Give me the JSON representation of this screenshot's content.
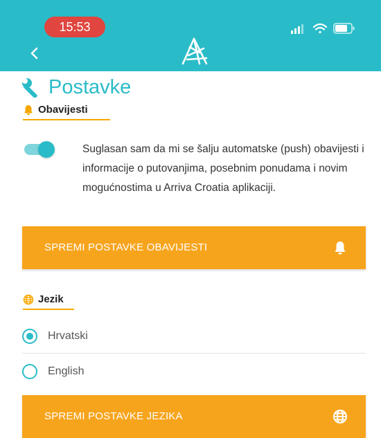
{
  "status_bar": {
    "time": "15:53"
  },
  "header": {
    "logo": "arriva-logo",
    "back_icon": "chevron-left-icon"
  },
  "page": {
    "title": "Postavke",
    "title_icon": "wrench-icon"
  },
  "notifications": {
    "heading": "Obavijesti",
    "heading_icon": "bell-icon",
    "toggle_on": true,
    "consent_text": "Suglasan sam da mi se šalju automatske (push) obavijesti i informacije o putovanjima, posebnim ponudama i novim mogućnostima u Arriva Croatia aplikaciji.",
    "save_label": "SPREMI POSTAVKE OBAVIJESTI",
    "save_icon": "bell-icon"
  },
  "language": {
    "heading": "Jezik",
    "heading_icon": "globe-icon",
    "options": [
      {
        "label": "Hrvatski",
        "selected": true
      },
      {
        "label": "English",
        "selected": false
      }
    ],
    "save_label": "SPREMI POSTAVKE JEZIKA",
    "save_icon": "globe-icon"
  },
  "colors": {
    "header": "#29bcc8",
    "accent": "#29bcc8",
    "button": "#f7a41d",
    "underline": "#f6a800",
    "time_pill": "#e0453f"
  }
}
